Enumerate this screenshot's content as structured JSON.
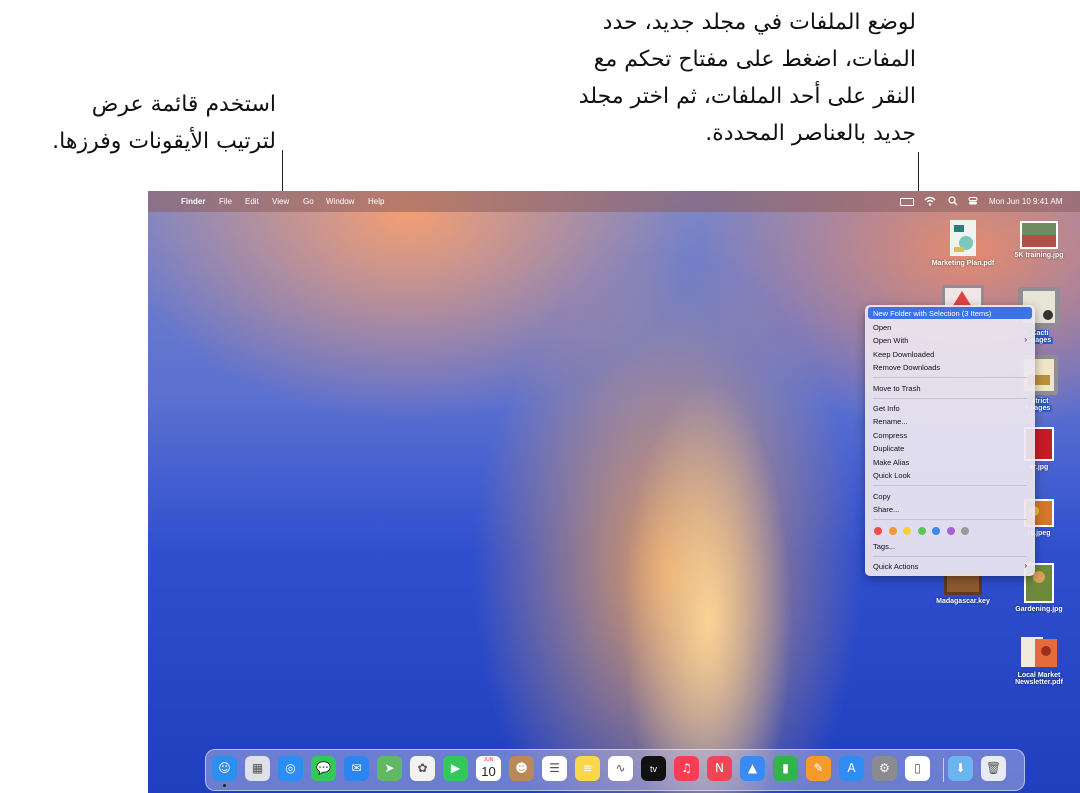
{
  "callouts": {
    "right_lines": [
      "لوضع الملفات في مجلد جديد، حدد",
      "المفات، اضغط على مفتاح تحكم مع",
      "النقر على أحد الملفات، ثم اختر مجلد",
      "جديد بالعناصر المحددة."
    ],
    "left_lines": [
      "استخدم قائمة عرض",
      "لترتيب الأيقونات وفرزها."
    ]
  },
  "menubar": {
    "apple": "",
    "app": "Finder",
    "items": [
      "File",
      "Edit",
      "View",
      "Go",
      "Window",
      "Help"
    ],
    "datetime": "Mon Jun 10  9:41 AM",
    "search_icon": "🔍",
    "wifi_icon": "wifi-icon",
    "battery_icon": "battery-icon",
    "control_center_icon": "control-center-icon"
  },
  "desktop_files": [
    {
      "label": "Marketing Plan.pdf",
      "icon": "pdf-document-icon"
    },
    {
      "label": "5K training.jpg",
      "icon": "photo-icon"
    },
    {
      "label": "Cacti",
      "label2": "n.pages",
      "icon": "pages-document-icon"
    },
    {
      "label": "strict",
      "label2": "t.pages",
      "icon": "pages-document-icon"
    },
    {
      "label": "er.jpg",
      "icon": "photo-icon"
    },
    {
      "label": "rs.jpeg",
      "icon": "photo-icon"
    },
    {
      "label": "Madagascar.key",
      "icon": "keynote-document-icon"
    },
    {
      "label": "Gardening.jpg",
      "icon": "photo-icon"
    },
    {
      "label": "Local Market",
      "label2": "Newsletter.pdf",
      "icon": "pdf-document-icon"
    }
  ],
  "context_menu": {
    "highlighted": "New Folder with Selection (3 Items)",
    "group1": [
      "Open",
      "Open With",
      "Keep Downloaded",
      "Remove Downloads"
    ],
    "group2": [
      "Move to Trash"
    ],
    "group3": [
      "Get Info",
      "Rename...",
      "Compress",
      "Duplicate",
      "Make Alias",
      "Quick Look"
    ],
    "group4": [
      "Copy",
      "Share..."
    ],
    "tags_label": "Tags...",
    "quick_actions": "Quick Actions",
    "submenu_chevron": "›",
    "tag_colors": [
      "#ee4c4c",
      "#f29a3a",
      "#f5cf3b",
      "#5fc35a",
      "#3f87e8",
      "#a85fd6",
      "#9a9a9a"
    ]
  },
  "dock": {
    "calendar_month": "JUN",
    "calendar_day": "10",
    "tv_label": "tv",
    "apps": [
      {
        "name": "finder-icon",
        "color": "#2f8cf0",
        "glyph": "☺"
      },
      {
        "name": "launchpad-icon",
        "color": "#e0e0ea",
        "glyph": "▦"
      },
      {
        "name": "safari-icon",
        "color": "#2c8df5",
        "glyph": "◎"
      },
      {
        "name": "messages-icon",
        "color": "#34c759",
        "glyph": "💬"
      },
      {
        "name": "mail-icon",
        "color": "#2d86f0",
        "glyph": "✉"
      },
      {
        "name": "maps-icon",
        "color": "#61b865",
        "glyph": "➤"
      },
      {
        "name": "photos-icon",
        "color": "#f2f2f2",
        "glyph": "✿"
      },
      {
        "name": "facetime-icon",
        "color": "#34c759",
        "glyph": "▶"
      },
      {
        "name": "calendar-icon",
        "color": "#ffffff",
        "glyph": ""
      },
      {
        "name": "contacts-icon",
        "color": "#b98a58",
        "glyph": "☻"
      },
      {
        "name": "reminders-icon",
        "color": "#ffffff",
        "glyph": "☰"
      },
      {
        "name": "notes-icon",
        "color": "#f8d74c",
        "glyph": "≡"
      },
      {
        "name": "freeform-icon",
        "color": "#ffffff",
        "glyph": "∿"
      },
      {
        "name": "tv-icon",
        "color": "#111111",
        "glyph": ""
      },
      {
        "name": "music-icon",
        "color": "#fa3d55",
        "glyph": "♫"
      },
      {
        "name": "news-icon",
        "color": "#f04556",
        "glyph": "N"
      },
      {
        "name": "keynote-icon",
        "color": "#3b8af0",
        "glyph": "▲"
      },
      {
        "name": "numbers-icon",
        "color": "#33b44a",
        "glyph": "▮"
      },
      {
        "name": "pages-icon",
        "color": "#f59b2c",
        "glyph": "✎"
      },
      {
        "name": "app-store-icon",
        "color": "#2f8cf0",
        "glyph": "A"
      },
      {
        "name": "system-settings-icon",
        "color": "#8a8a90",
        "glyph": "⚙"
      },
      {
        "name": "iphone-mirroring-icon",
        "color": "#ffffff",
        "glyph": "▯"
      },
      {
        "name": "downloads-folder-icon",
        "color": "#6ab4f0",
        "glyph": "⬇"
      },
      {
        "name": "trash-icon",
        "color": "#e8ecf2",
        "glyph": "🗑"
      }
    ]
  }
}
